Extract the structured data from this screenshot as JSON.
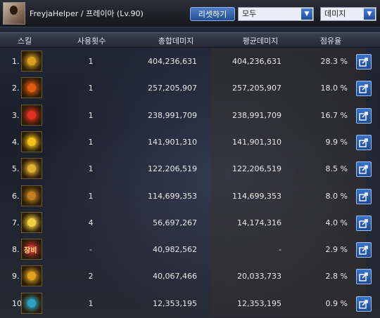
{
  "header": {
    "user_label": "FreyjaHelper  /  프레이아 (Lv.90)",
    "reset_label": "리셋하기",
    "filter_value": "모두",
    "metric_value": "데미지"
  },
  "columns": {
    "skill": "스킬",
    "uses": "사용횟수",
    "total": "총합데미지",
    "avg": "평균데미지",
    "share": "점유율"
  },
  "rows": [
    {
      "rank": "1.",
      "uses": "1",
      "total": "404,236,631",
      "avg": "404,236,631",
      "share": "28.3 %",
      "icon": "skill-1-icon",
      "color": "#d8a020"
    },
    {
      "rank": "2.",
      "uses": "1",
      "total": "257,205,907",
      "avg": "257,205,907",
      "share": "18.0 %",
      "icon": "skill-2-icon",
      "color": "#e05a10"
    },
    {
      "rank": "3.",
      "uses": "1",
      "total": "238,991,709",
      "avg": "238,991,709",
      "share": "16.7 %",
      "icon": "skill-3-icon",
      "color": "#e03020"
    },
    {
      "rank": "4.",
      "uses": "1",
      "total": "141,901,310",
      "avg": "141,901,310",
      "share": "9.9 %",
      "icon": "skill-4-icon",
      "color": "#f0c020"
    },
    {
      "rank": "5.",
      "uses": "1",
      "total": "122,206,519",
      "avg": "122,206,519",
      "share": "8.5 %",
      "icon": "skill-5-icon",
      "color": "#e0b030"
    },
    {
      "rank": "6.",
      "uses": "1",
      "total": "114,699,353",
      "avg": "114,699,353",
      "share": "8.0 %",
      "icon": "skill-6-icon",
      "color": "#c08020"
    },
    {
      "rank": "7.",
      "uses": "4",
      "total": "56,697,267",
      "avg": "14,174,316",
      "share": "4.0 %",
      "icon": "skill-7-icon",
      "color": "#f0d040"
    },
    {
      "rank": "8.",
      "uses": "-",
      "total": "40,982,562",
      "avg": "-",
      "share": "2.9 %",
      "icon": "skill-8-icon",
      "color": "#c03030",
      "label": "장비"
    },
    {
      "rank": "9.",
      "uses": "2",
      "total": "40,067,466",
      "avg": "20,033,733",
      "share": "2.8 %",
      "icon": "skill-9-icon",
      "color": "#e0a020"
    },
    {
      "rank": "10.",
      "uses": "1",
      "total": "12,353,195",
      "avg": "12,353,195",
      "share": "0.9 %",
      "icon": "skill-10-icon",
      "color": "#30a0c0"
    }
  ]
}
